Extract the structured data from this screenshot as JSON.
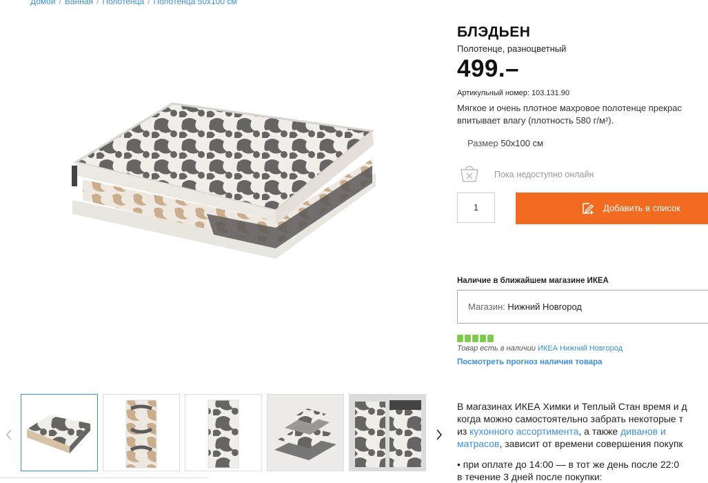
{
  "breadcrumb": [
    "Домой",
    "Ванная",
    "Полотенца",
    "Полотенца 50x100 см"
  ],
  "product": {
    "name": "БЛЭДЬЕН",
    "subtitle": "Полотенце, разноцветный",
    "price": "499.–",
    "article": "Артикульный номер: 103.131.90",
    "description": "Мягкое и очень плотное махровое полотенце прекрас\nвпитывает влагу (плотность 580 г/м²).",
    "size_label": "Размер",
    "size_value": "50x100 см"
  },
  "purchase": {
    "unavailable_text": "Пока недоступно онлайн",
    "quantity": "1",
    "add_button_label": "Добавить в список"
  },
  "store": {
    "heading": "Наличие в ближайшем магазине ИКЕА",
    "select_label": "Магазин:",
    "select_value": "Нижний Новгород",
    "stock_text": "Товар есть в наличии",
    "stock_store_link": "ИКЕА Нижний Новгород",
    "stock_level": 5,
    "forecast_link": "Посмотреть прогноз наличия товара"
  },
  "delivery_info": {
    "line1": "В магазинах ИКЕА Химки и Теплый Стан время и д",
    "line2": "когда можно самостоятельно забрать некоторые т",
    "line3_pre": "из ",
    "line3_link1": "кухонного ассортимента",
    "line3_mid": ", а также ",
    "line3_link2": "диванов и",
    "line4_link": "матрасов",
    "line4_post": ", зависит от времени совершения покупк",
    "bullet1": "• при оплате до 14:00 — в тот же день после 22:0",
    "bullet1_cont": "в течение 3 дней после покупки:"
  },
  "thumbnails": [
    "folded-towel",
    "towel-beige-pattern",
    "towel-grey-pattern",
    "towel-stack",
    "towels-hanging"
  ],
  "colors": {
    "accent": "#f26b21",
    "link": "#3d8fd6",
    "stock": "#7ec850"
  }
}
